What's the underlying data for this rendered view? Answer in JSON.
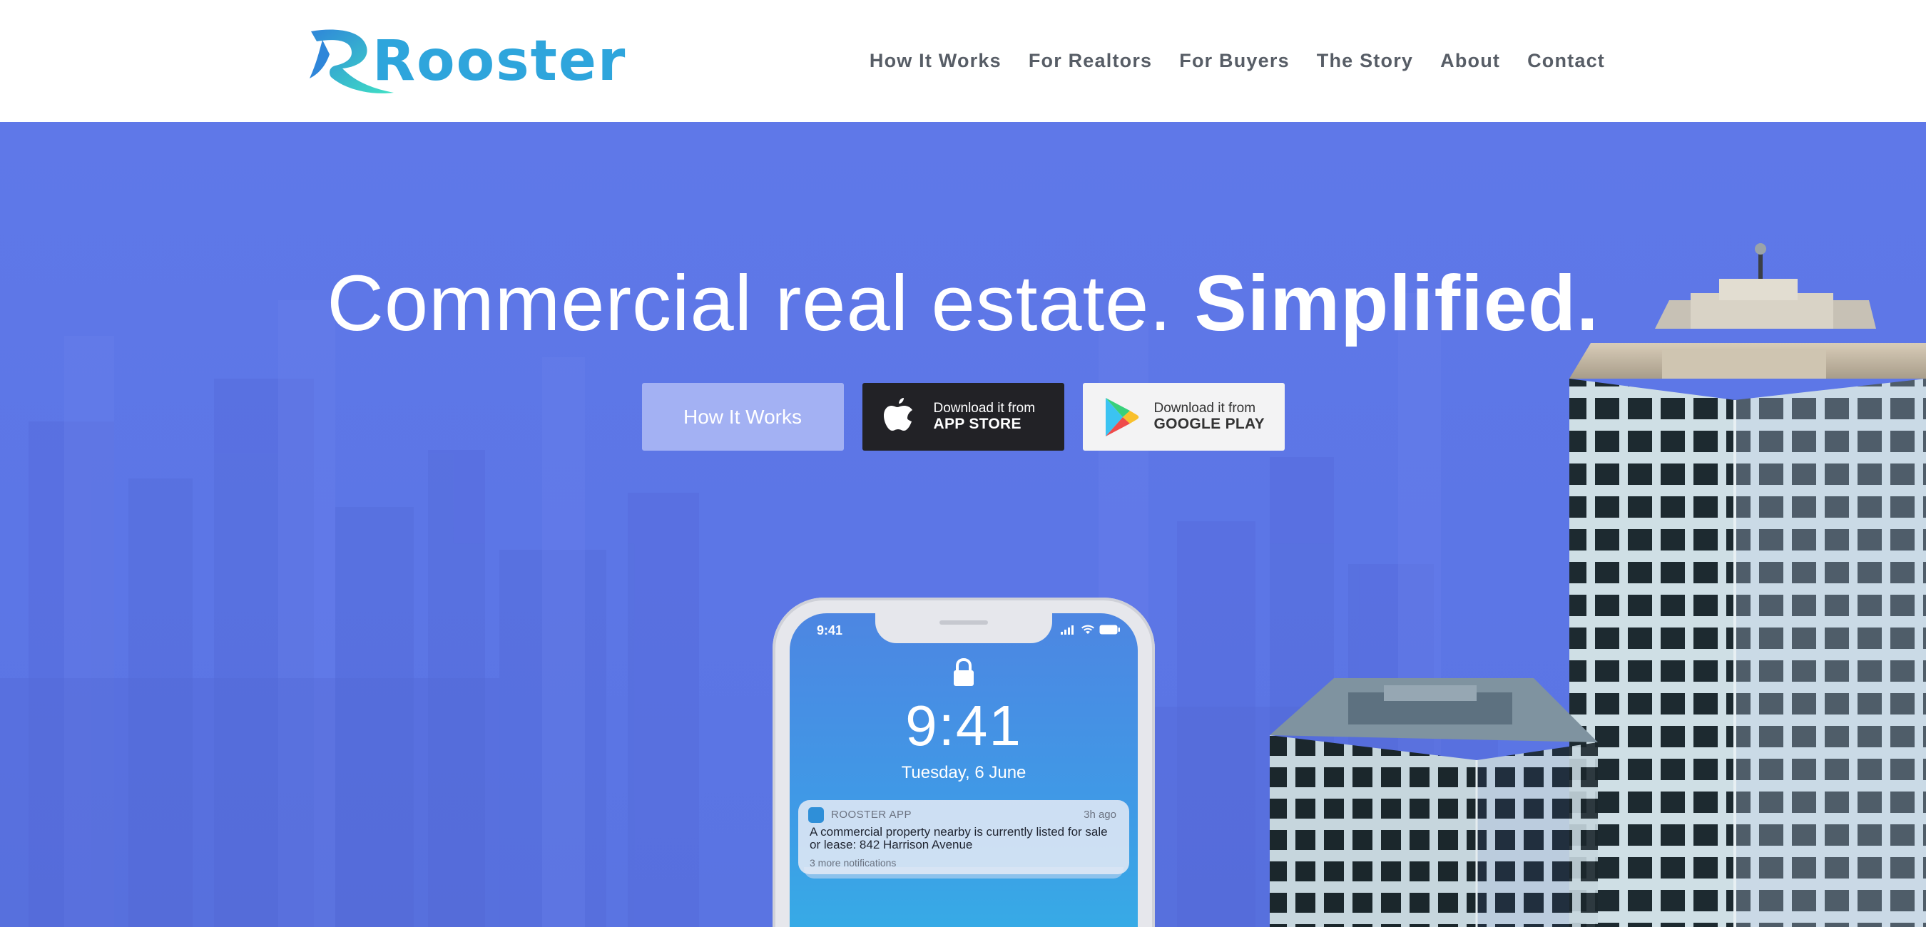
{
  "brand": {
    "logo_text": "Rooster",
    "primary_color": "#2ea5dc",
    "accent_color": "#3cd6c4"
  },
  "nav": {
    "items": [
      {
        "label": "How It Works"
      },
      {
        "label": "For Realtors"
      },
      {
        "label": "For Buyers"
      },
      {
        "label": "The Story"
      },
      {
        "label": "About"
      },
      {
        "label": "Contact"
      }
    ]
  },
  "hero": {
    "title_light": "Commercial real estate.",
    "title_bold": "Simplified.",
    "background_color": "#5f78e8",
    "cta": {
      "how_label": "How It Works",
      "app_store": {
        "small": "Download it from",
        "big": "APP STORE",
        "icon": "apple-icon"
      },
      "google_play": {
        "small": "Download it from",
        "big": "GOOGLE PLAY",
        "icon": "google-play-icon"
      }
    }
  },
  "phone": {
    "status_time": "9:41",
    "lock_time": "9:41",
    "lock_date": "Tuesday, 6 June",
    "notification": {
      "app_name": "ROOSTER APP",
      "time": "3h ago",
      "body": "A commercial property nearby is currently listed for sale or lease: 842 Harrison Avenue",
      "more": "3 more notifications"
    }
  }
}
